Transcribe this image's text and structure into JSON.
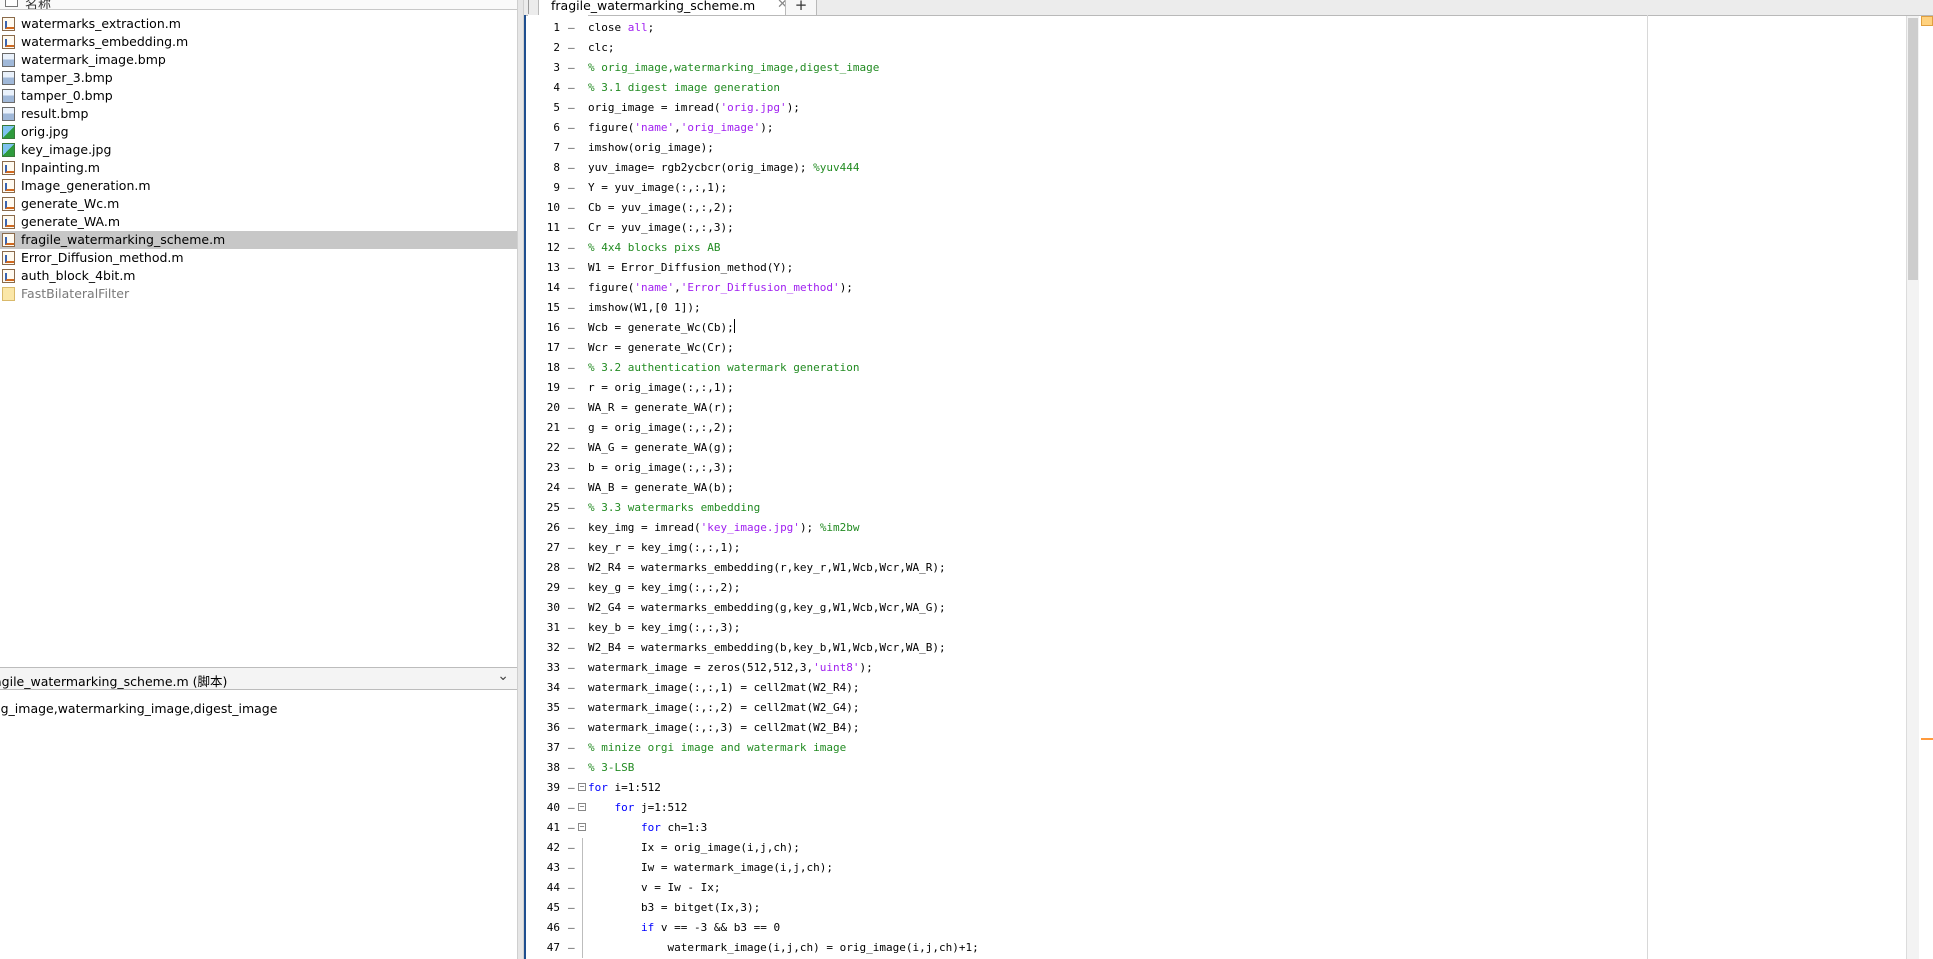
{
  "file_browser": {
    "header_label": "名称",
    "files": [
      {
        "name": "watermarks_extraction.m",
        "type": "m"
      },
      {
        "name": "watermarks_embedding.m",
        "type": "m"
      },
      {
        "name": "watermark_image.bmp",
        "type": "bmp"
      },
      {
        "name": "tamper_3.bmp",
        "type": "bmp"
      },
      {
        "name": "tamper_0.bmp",
        "type": "bmp"
      },
      {
        "name": "result.bmp",
        "type": "bmp"
      },
      {
        "name": "orig.jpg",
        "type": "jpg"
      },
      {
        "name": "key_image.jpg",
        "type": "jpg"
      },
      {
        "name": "Inpainting.m",
        "type": "m"
      },
      {
        "name": "Image_generation.m",
        "type": "m"
      },
      {
        "name": "generate_Wc.m",
        "type": "m"
      },
      {
        "name": "generate_WA.m",
        "type": "m"
      },
      {
        "name": "fragile_watermarking_scheme.m",
        "type": "m",
        "selected": true
      },
      {
        "name": "Error_Diffusion_method.m",
        "type": "m"
      },
      {
        "name": "auth_block_4bit.m",
        "type": "m"
      },
      {
        "name": "FastBilateralFilter",
        "type": "folder"
      }
    ]
  },
  "details": {
    "title": "agile_watermarking_scheme.m  (脚本)",
    "body": "rig_image,watermarking_image,digest_image"
  },
  "editor": {
    "tab_label": "fragile_watermarking_scheme.m",
    "close_glyph": "✕",
    "new_tab_glyph": "+",
    "fold_glyph": "−",
    "lines": [
      [
        {
          "t": "close ",
          "c": ""
        },
        {
          "t": "all",
          "c": "str"
        },
        {
          "t": ";",
          "c": ""
        }
      ],
      [
        {
          "t": "clc;",
          "c": ""
        }
      ],
      [
        {
          "t": "% orig_image,watermarking_image,digest_image",
          "c": "com"
        }
      ],
      [
        {
          "t": "% 3.1 digest image generation",
          "c": "com"
        }
      ],
      [
        {
          "t": "orig_image = imread(",
          "c": ""
        },
        {
          "t": "'orig.jpg'",
          "c": "str"
        },
        {
          "t": ");",
          "c": ""
        }
      ],
      [
        {
          "t": "figure(",
          "c": ""
        },
        {
          "t": "'name'",
          "c": "str"
        },
        {
          "t": ",",
          "c": ""
        },
        {
          "t": "'orig_image'",
          "c": "str"
        },
        {
          "t": ");",
          "c": ""
        }
      ],
      [
        {
          "t": "imshow(orig_image);",
          "c": ""
        }
      ],
      [
        {
          "t": "yuv_image= rgb2ycbcr(orig_image); ",
          "c": ""
        },
        {
          "t": "%yuv444",
          "c": "com"
        }
      ],
      [
        {
          "t": "Y = yuv_image(:,:,1);",
          "c": ""
        }
      ],
      [
        {
          "t": "Cb = yuv_image(:,:,2);",
          "c": ""
        }
      ],
      [
        {
          "t": "Cr = yuv_image(:,:,3);",
          "c": ""
        }
      ],
      [
        {
          "t": "% 4x4 blocks pixs AB",
          "c": "com"
        }
      ],
      [
        {
          "t": "W1 = Error_Diffusion_method(Y);",
          "c": ""
        }
      ],
      [
        {
          "t": "figure(",
          "c": ""
        },
        {
          "t": "'name'",
          "c": "str"
        },
        {
          "t": ",",
          "c": ""
        },
        {
          "t": "'Error_Diffusion_method'",
          "c": "str"
        },
        {
          "t": ");",
          "c": ""
        }
      ],
      [
        {
          "t": "imshow(W1,[0 1]);",
          "c": ""
        }
      ],
      [
        {
          "t": "Wcb = generate_Wc(Cb);",
          "c": ""
        }
      ],
      [
        {
          "t": "Wcr = generate_Wc(Cr);",
          "c": ""
        }
      ],
      [
        {
          "t": "% 3.2 authentication watermark generation",
          "c": "com"
        }
      ],
      [
        {
          "t": "r = orig_image(:,:,1);",
          "c": ""
        }
      ],
      [
        {
          "t": "WA_R = generate_WA(r);",
          "c": ""
        }
      ],
      [
        {
          "t": "g = orig_image(:,:,2);",
          "c": ""
        }
      ],
      [
        {
          "t": "WA_G = generate_WA(g);",
          "c": ""
        }
      ],
      [
        {
          "t": "b = orig_image(:,:,3);",
          "c": ""
        }
      ],
      [
        {
          "t": "WA_B = generate_WA(b);",
          "c": ""
        }
      ],
      [
        {
          "t": "% 3.3 watermarks embedding",
          "c": "com"
        }
      ],
      [
        {
          "t": "key_img = imread(",
          "c": ""
        },
        {
          "t": "'key_image.jpg'",
          "c": "str"
        },
        {
          "t": "); ",
          "c": ""
        },
        {
          "t": "%im2bw",
          "c": "com"
        }
      ],
      [
        {
          "t": "key_r = key_img(:,:,1);",
          "c": ""
        }
      ],
      [
        {
          "t": "W2_R4 = watermarks_embedding(r,key_r,W1,Wcb,Wcr,WA_R);",
          "c": ""
        }
      ],
      [
        {
          "t": "key_g = key_img(:,:,2);",
          "c": ""
        }
      ],
      [
        {
          "t": "W2_G4 = watermarks_embedding(g,key_g,W1,Wcb,Wcr,WA_G);",
          "c": ""
        }
      ],
      [
        {
          "t": "key_b = key_img(:,:,3);",
          "c": ""
        }
      ],
      [
        {
          "t": "W2_B4 = watermarks_embedding(b,key_b,W1,Wcb,Wcr,WA_B);",
          "c": ""
        }
      ],
      [
        {
          "t": "watermark_image = zeros(512,512,3,",
          "c": ""
        },
        {
          "t": "'uint8'",
          "c": "str"
        },
        {
          "t": ");",
          "c": ""
        }
      ],
      [
        {
          "t": "watermark_image(:,:,1) = cell2mat(W2_R4);",
          "c": ""
        }
      ],
      [
        {
          "t": "watermark_image(:,:,2) = cell2mat(W2_G4);",
          "c": ""
        }
      ],
      [
        {
          "t": "watermark_image(:,:,3) = cell2mat(W2_B4);",
          "c": ""
        }
      ],
      [
        {
          "t": "% minize orgi image and watermark image",
          "c": "com"
        }
      ],
      [
        {
          "t": "% 3-LSB",
          "c": "com"
        }
      ],
      [
        {
          "t": "for ",
          "c": "kw"
        },
        {
          "t": "i=1:512",
          "c": ""
        }
      ],
      [
        {
          "t": "    ",
          "c": ""
        },
        {
          "t": "for ",
          "c": "kw"
        },
        {
          "t": "j=1:512",
          "c": ""
        }
      ],
      [
        {
          "t": "        ",
          "c": ""
        },
        {
          "t": "for ",
          "c": "kw"
        },
        {
          "t": "ch=1:3",
          "c": ""
        }
      ],
      [
        {
          "t": "        Ix = orig_image(i,j,ch);",
          "c": ""
        }
      ],
      [
        {
          "t": "        Iw = watermark_image(i,j,ch);",
          "c": ""
        }
      ],
      [
        {
          "t": "        v = Iw - Ix;",
          "c": ""
        }
      ],
      [
        {
          "t": "        b3 = bitget(Ix,3);",
          "c": ""
        }
      ],
      [
        {
          "t": "        ",
          "c": ""
        },
        {
          "t": "if ",
          "c": "kw"
        },
        {
          "t": "v == -3 && b3 == 0",
          "c": ""
        }
      ],
      [
        {
          "t": "            watermark_image(i,j,ch) = orig_image(i,j,ch)+1;",
          "c": ""
        }
      ]
    ]
  }
}
